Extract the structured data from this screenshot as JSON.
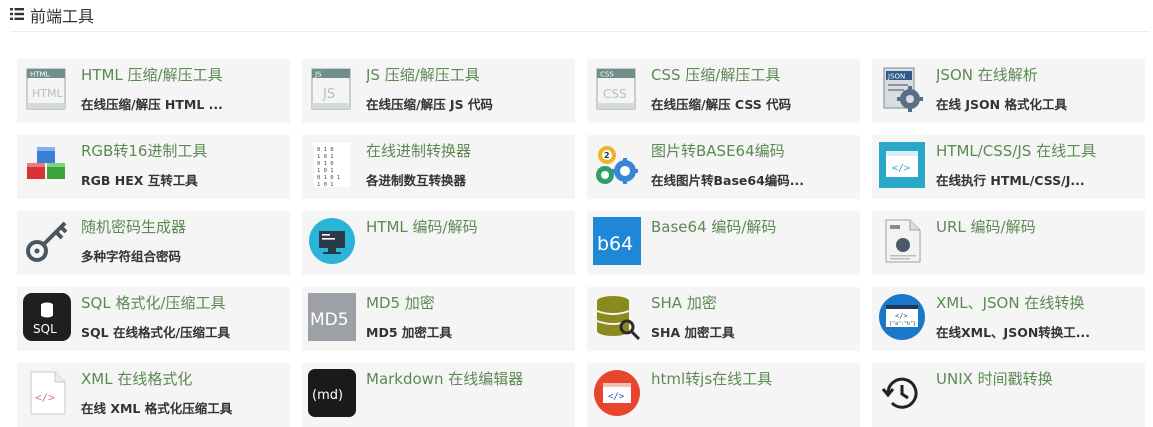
{
  "header": {
    "title": "前端工具",
    "icon": "list-icon"
  },
  "tools": [
    {
      "name": "tool-html-minify",
      "icon": "html-file-icon",
      "title": "HTML 压缩/解压工具",
      "subtitle": "在线压缩/解压 HTML ..."
    },
    {
      "name": "tool-js-minify",
      "icon": "js-file-icon",
      "title": "JS 压缩/解压工具",
      "subtitle": "在线压缩/解压 JS 代码"
    },
    {
      "name": "tool-css-minify",
      "icon": "css-file-icon",
      "title": "CSS 压缩/解压工具",
      "subtitle": "在线压缩/解压 CSS 代码"
    },
    {
      "name": "tool-json-parse",
      "icon": "json-gear-icon",
      "title": "JSON 在线解析",
      "subtitle": "在线 JSON 格式化工具"
    },
    {
      "name": "tool-rgb-hex",
      "icon": "rgb-cubes-icon",
      "title": "RGB转16进制工具",
      "subtitle": "RGB HEX 互转工具"
    },
    {
      "name": "tool-base-convert",
      "icon": "binary-digits-icon",
      "title": "在线进制转换器",
      "subtitle": "各进制数互转换器"
    },
    {
      "name": "tool-image-base64",
      "icon": "gears-icon",
      "title": "图片转BASE64编码",
      "subtitle": "在线图片转Base64编码..."
    },
    {
      "name": "tool-html-css-js-run",
      "icon": "browser-code-icon",
      "title": "HTML/CSS/JS 在线工具",
      "subtitle": "在线执行 HTML/CSS/J..."
    },
    {
      "name": "tool-password-generator",
      "icon": "key-icon",
      "title": "随机密码生成器",
      "subtitle": "多种字符组合密码"
    },
    {
      "name": "tool-html-encode",
      "icon": "monitor-icon",
      "title": "HTML 编码/解码",
      "subtitle": ""
    },
    {
      "name": "tool-base64",
      "icon": "b64-icon",
      "icon_text": "b64",
      "title": "Base64 编码/解码",
      "subtitle": ""
    },
    {
      "name": "tool-url-encode",
      "icon": "url-document-icon",
      "title": "URL 编码/解码",
      "subtitle": ""
    },
    {
      "name": "tool-sql-format",
      "icon": "sql-database-icon",
      "icon_text": "SQL",
      "title": "SQL 格式化/压缩工具",
      "subtitle": "SQL 在线格式化/压缩工具"
    },
    {
      "name": "tool-md5",
      "icon": "md5-icon",
      "icon_text": "MD5",
      "title": "MD5 加密",
      "subtitle": "MD5 加密工具"
    },
    {
      "name": "tool-sha",
      "icon": "sha-database-key-icon",
      "title": "SHA 加密",
      "subtitle": "SHA 加密工具"
    },
    {
      "name": "tool-xml-json",
      "icon": "xml-json-icon",
      "title": "XML、JSON 在线转换",
      "subtitle": "在线XML、JSON转换工..."
    },
    {
      "name": "tool-xml-format",
      "icon": "xml-file-icon",
      "title": "XML 在线格式化",
      "subtitle": "在线 XML 格式化压缩工具"
    },
    {
      "name": "tool-markdown",
      "icon": "markdown-icon",
      "icon_text": "(md)",
      "title": "Markdown 在线编辑器",
      "subtitle": ""
    },
    {
      "name": "tool-html-to-js",
      "icon": "code-circle-icon",
      "title": "html转js在线工具",
      "subtitle": ""
    },
    {
      "name": "tool-unix-time",
      "icon": "history-clock-icon",
      "title": "UNIX 时间戳转换",
      "subtitle": ""
    }
  ]
}
